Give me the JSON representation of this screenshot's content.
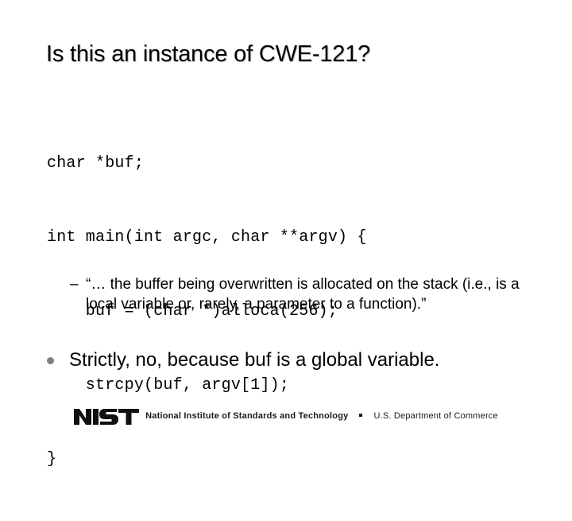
{
  "slide": {
    "title": "Is this an instance of CWE-121?",
    "code": {
      "lines": [
        "char *buf;",
        "int main(int argc, char **argv) {",
        "    buf = (char *)alloca(256);",
        "    strcpy(buf, argv[1]);",
        "}"
      ]
    },
    "quote": {
      "marker": "–",
      "text": "“… the buffer being overwritten is allocated on the stack (i.e., is a local variable or, rarely, a parameter to a function).”"
    },
    "bullet": {
      "marker": "round-bullet",
      "text": "Strictly, no, because buf is a global variable."
    }
  },
  "footer": {
    "logo_name": "nist-logo",
    "logo_text": "NIST",
    "tagline": "National Institute of Standards and Technology",
    "separator": "•",
    "department": "U.S. Department of Commerce"
  },
  "colors": {
    "background": "#ffffff",
    "text": "#000000",
    "bullet": "#808080",
    "footer_text": "#1a1a1a",
    "title_shadow": "#969696"
  }
}
